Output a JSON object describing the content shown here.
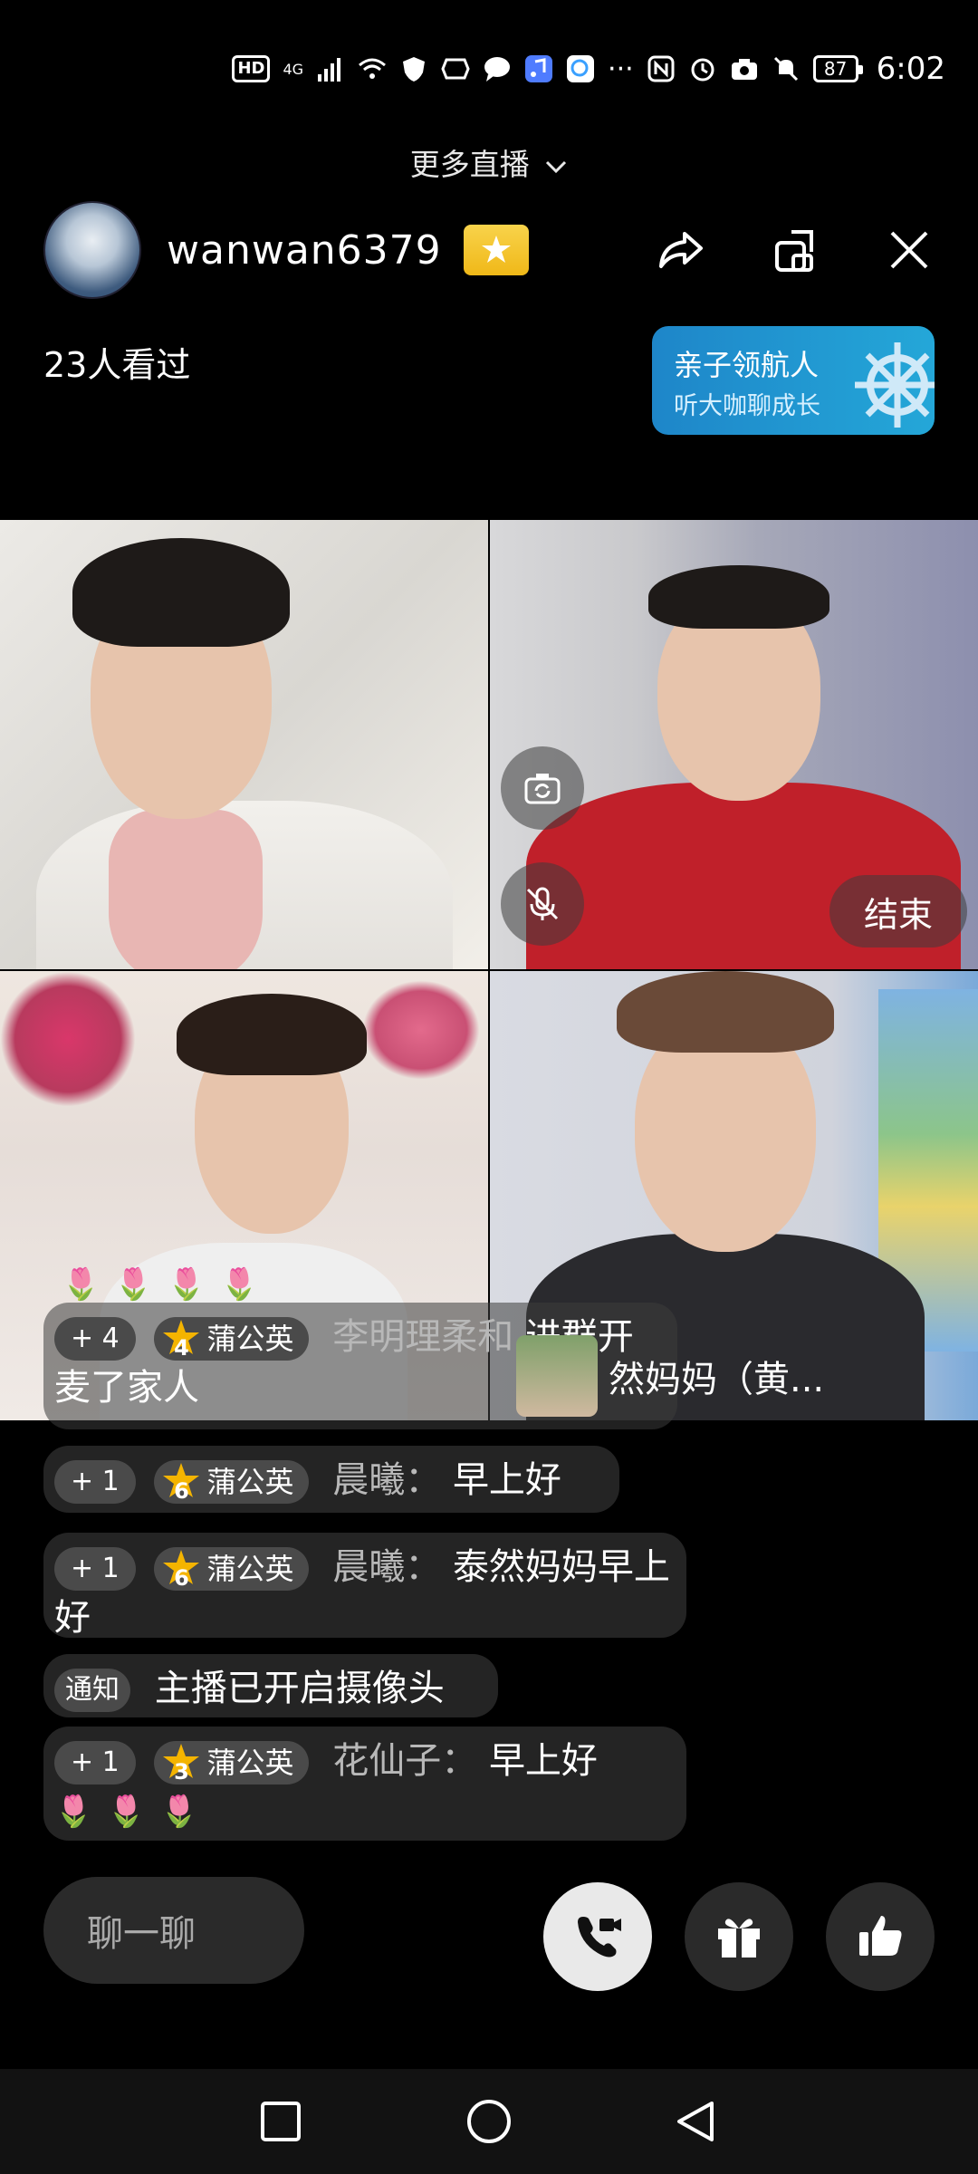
{
  "status_bar": {
    "hd_label": "HD",
    "network": "4G",
    "battery": "87",
    "time": "6:02"
  },
  "more_live_label": "更多直播",
  "host": {
    "name": "wanwan6379",
    "viewers": "23人看过"
  },
  "promo": {
    "title": "亲子领航人",
    "subtitle": "听大咖聊成长"
  },
  "video_tiles": {
    "end_label": "结束"
  },
  "chat": {
    "messages": [
      {
        "plus": "+ 4",
        "level": "4",
        "fan_tag": "蒲公英",
        "user": "李明理柔和",
        "text": "进群开麦了家人"
      },
      {
        "plus": "+ 1",
        "level": "6",
        "fan_tag": "蒲公英",
        "user": "晨曦：",
        "text": "早上好"
      },
      {
        "plus": "+ 1",
        "level": "6",
        "fan_tag": "蒲公英",
        "user": "晨曦：",
        "text": "泰然妈妈早上好"
      },
      {
        "notice": "通知",
        "text": "主播已开启摄像头"
      },
      {
        "plus": "+ 1",
        "level": "3",
        "fan_tag": "蒲公英",
        "user": "花仙子：",
        "text": "早上好"
      }
    ],
    "overlay_text": "然妈妈（黄..."
  },
  "bottom_bar": {
    "chat_placeholder": "聊一聊"
  },
  "colors": {
    "background": "#000000",
    "vip_badge": "#f5c52e",
    "promo": "#1e9ad2",
    "chat_bubble": "#323232"
  }
}
